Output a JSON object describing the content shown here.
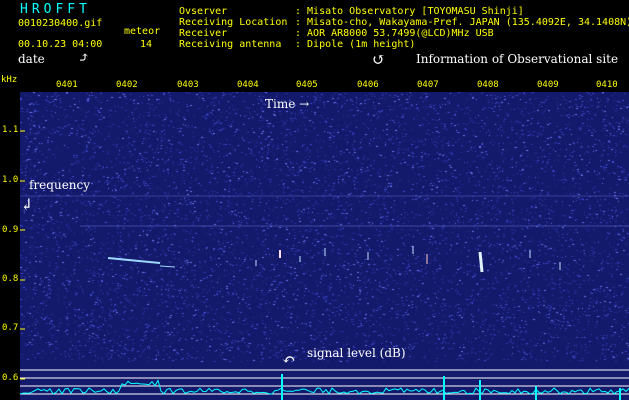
{
  "header": {
    "app_title": "HROFFT",
    "file_name": "0010230400.gif",
    "datetime": "00.10.23 04:00",
    "meteor_label": "meteor",
    "meteor_count": "14",
    "info_labels": "Ovserver\nReceiving Location\nReceiver\nReceiving antenna",
    "info_values": ": Misato Observatory [TOYOMASU Shinji]\n: Misato-cho, Wakayama-Pref. JAPAN (135.4092E, 34.1408N)\n: AOR AR8000 53.7499(@LCD)MHz USB\n: Dipole (1m height)"
  },
  "annotations": {
    "date": "date",
    "observational_site": "Information of Observational site",
    "time": "Time →",
    "frequency": "frequency",
    "signal_level": "signal level (dB)"
  },
  "axes": {
    "y_unit": "kHz",
    "x_ticks": [
      "0401",
      "0402",
      "0403",
      "0404",
      "0405",
      "0406",
      "0407",
      "0408",
      "0409",
      "0410"
    ],
    "y_ticks": [
      "1.1",
      "1.0",
      "0.9",
      "0.8",
      "0.7",
      "0.6"
    ]
  },
  "colors": {
    "background": "#141a6b",
    "header_text": "#ffff00",
    "title_text": "#00ffff",
    "signal_trace": "#00ffff",
    "annotation_text": "#ffffff"
  },
  "icons": {
    "date_arrow": "curved-arrow-icon",
    "info_arrow": "curved-arrow-icon",
    "frequency_arrow": "curved-arrow-icon",
    "signal_arrow": "curved-arrow-icon"
  }
}
